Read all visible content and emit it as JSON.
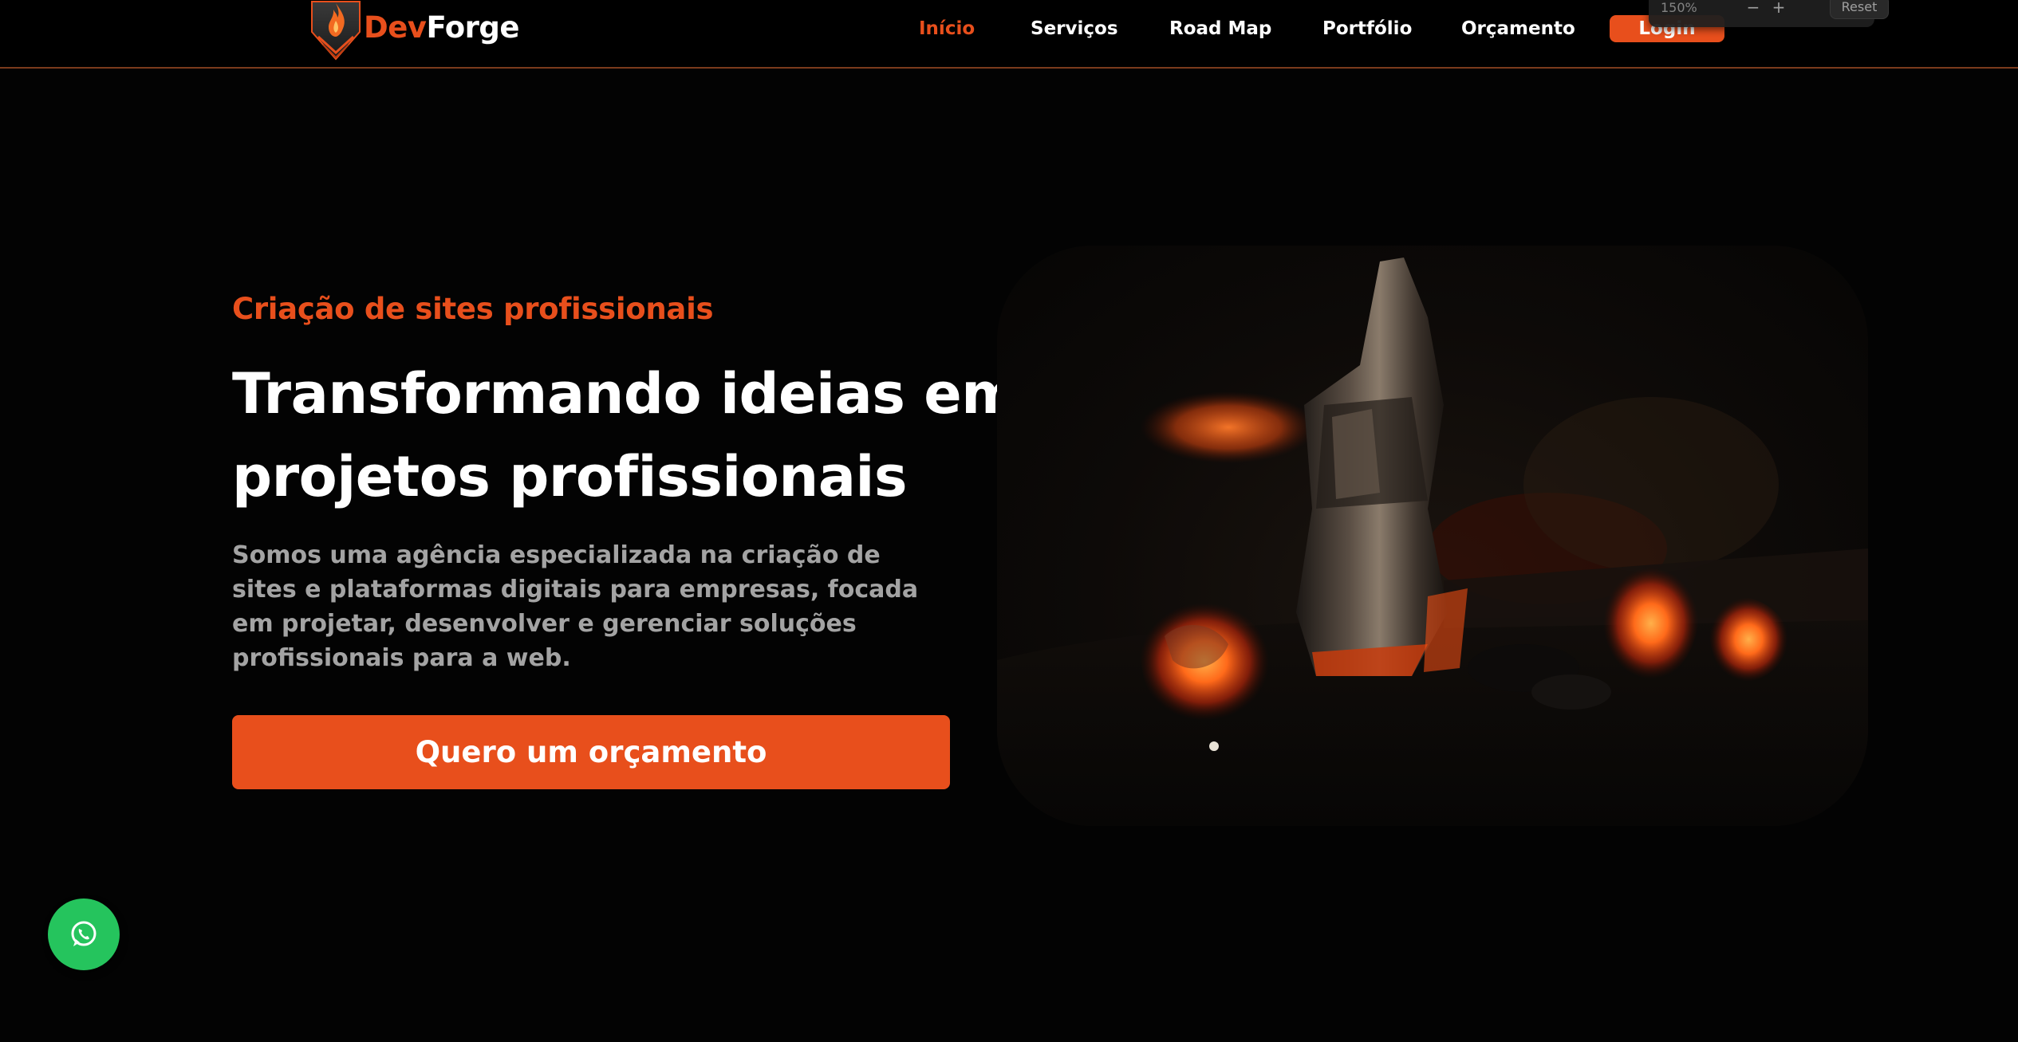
{
  "brand": {
    "part1": "Dev",
    "part2": "Forge",
    "accent_color": "#e84f1c",
    "logo_icon": "flame-shield-icon"
  },
  "nav": {
    "items": [
      {
        "label": "Início",
        "active": true
      },
      {
        "label": "Serviços",
        "active": false
      },
      {
        "label": "Road Map",
        "active": false
      },
      {
        "label": "Portfólio",
        "active": false
      },
      {
        "label": "Orçamento",
        "active": false
      }
    ],
    "login_label": "Login"
  },
  "zoom_popup": {
    "level": "150%",
    "minus_label": "−",
    "plus_label": "+",
    "reset_label": "Reset"
  },
  "hero": {
    "eyebrow": "Criação de sites profissionais",
    "headline_line1": "Transformando ideias em",
    "headline_line2": "projetos profissionais",
    "description": "Somos uma agência especializada na criação de sites e plataformas digitais para empresas, focada em projetar, desenvolver e gerenciar soluções profissionais para a web.",
    "cta_label": "Quero um orçamento",
    "image_icon": "forge-hammer-embers-image"
  },
  "whatsapp": {
    "icon": "whatsapp-icon",
    "color": "#25c45d"
  }
}
